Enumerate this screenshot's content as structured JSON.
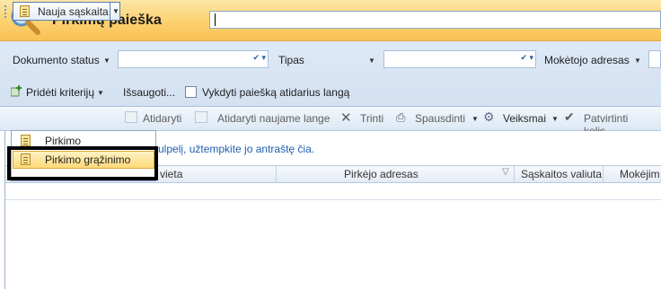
{
  "header": {
    "title": "Pirkimų paieška",
    "icon": "magnifier-icon",
    "search_value": ""
  },
  "filters": {
    "row1": [
      {
        "label": "Dokumento status",
        "value": ""
      },
      {
        "label": "Tipas",
        "value": ""
      },
      {
        "label": "Mokėtojo adresas",
        "value": ""
      }
    ],
    "add_criteria": "Pridėti kriterijų",
    "save": "Išsaugoti...",
    "open_in_new": "Vykdyti paiešką atidarius langą",
    "open_in_new_checked": false
  },
  "toolbar": {
    "new_invoice": "Nauja sąskaita",
    "open": "Atidaryti",
    "open_new_window": "Atidaryti naujame lange",
    "delete": "Trinti",
    "print": "Spausdinti",
    "actions": "Veiksmai",
    "confirm": "Patvirtinti kelis..."
  },
  "menu": {
    "items": [
      {
        "label": "Pirkimo",
        "highlighted": false
      },
      {
        "label": "Pirkimo grąžinimo",
        "highlighted": true
      }
    ]
  },
  "grid": {
    "group_hint_visible": "ulpelį, užtempkite jo antraštę čia.",
    "columns": [
      "Pirkėjo vieta",
      "Pirkėjo adresas",
      "Sąskaitos valiuta",
      "Mokėjim"
    ]
  },
  "colors": {
    "accent": "#fcd16f",
    "link": "#1f5fb0",
    "highlight": "#fdd978"
  }
}
